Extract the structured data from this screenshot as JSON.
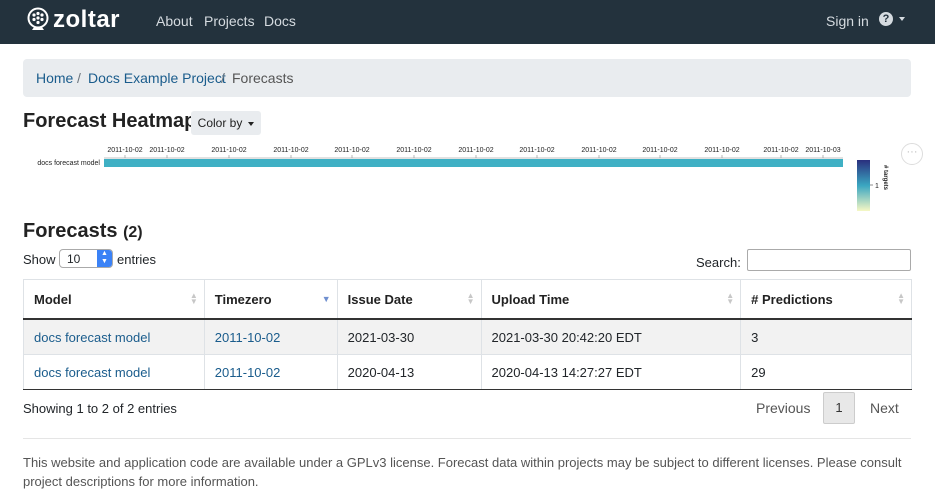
{
  "nav": {
    "brand": "zoltar",
    "links": [
      "About",
      "Projects",
      "Docs"
    ],
    "sign_in": "Sign in",
    "help_glyph": "?"
  },
  "breadcrumb": {
    "home": "Home",
    "project": "Docs Example Project",
    "current": "Forecasts",
    "sep": "/"
  },
  "heatmap": {
    "title": "Forecast Heatmap",
    "color_by": "Color by",
    "row_label": "docs forecast model",
    "tick_labels": [
      "2011-10-02",
      "2011-10-02",
      "2011-10-02",
      "2011-10-02",
      "2011-10-02",
      "2011-10-02",
      "2011-10-02",
      "2011-10-02",
      "2011-10-02",
      "2011-10-02",
      "2011-10-02",
      "2011-10-02",
      "2011-10-03"
    ],
    "colorbar_title": "# targets",
    "colorbar_tick": "1",
    "more_glyph": "···",
    "colors": {
      "bar": "#3fb0c4",
      "cb_top": "#2a2f7e",
      "cb_mid": "#3aa6c1",
      "cb_bottom": "#f6f8c4"
    }
  },
  "forecasts": {
    "title": "Forecasts",
    "count": "(2)",
    "show_label": "Show",
    "page_size": "10",
    "entries_label": "entries",
    "search_label": "Search:",
    "search_value": "",
    "columns": [
      "Model",
      "Timezero",
      "Issue Date",
      "Upload Time",
      "# Predictions"
    ],
    "rows": [
      {
        "model": "docs forecast model",
        "timezero": "2011-10-02",
        "issue_date": "2021-03-30",
        "upload_time": "2021-03-30 20:42:20 EDT",
        "predictions": "3"
      },
      {
        "model": "docs forecast model",
        "timezero": "2011-10-02",
        "issue_date": "2020-04-13",
        "upload_time": "2020-04-13 14:27:27 EDT",
        "predictions": "29"
      }
    ],
    "info": "Showing 1 to 2 of 2 entries",
    "prev": "Previous",
    "page": "1",
    "next": "Next"
  },
  "footer": {
    "text": "This website and application code are available under a GPLv3 license. Forecast data within projects may be subject to different licenses. Please consult project descriptions for more information."
  }
}
